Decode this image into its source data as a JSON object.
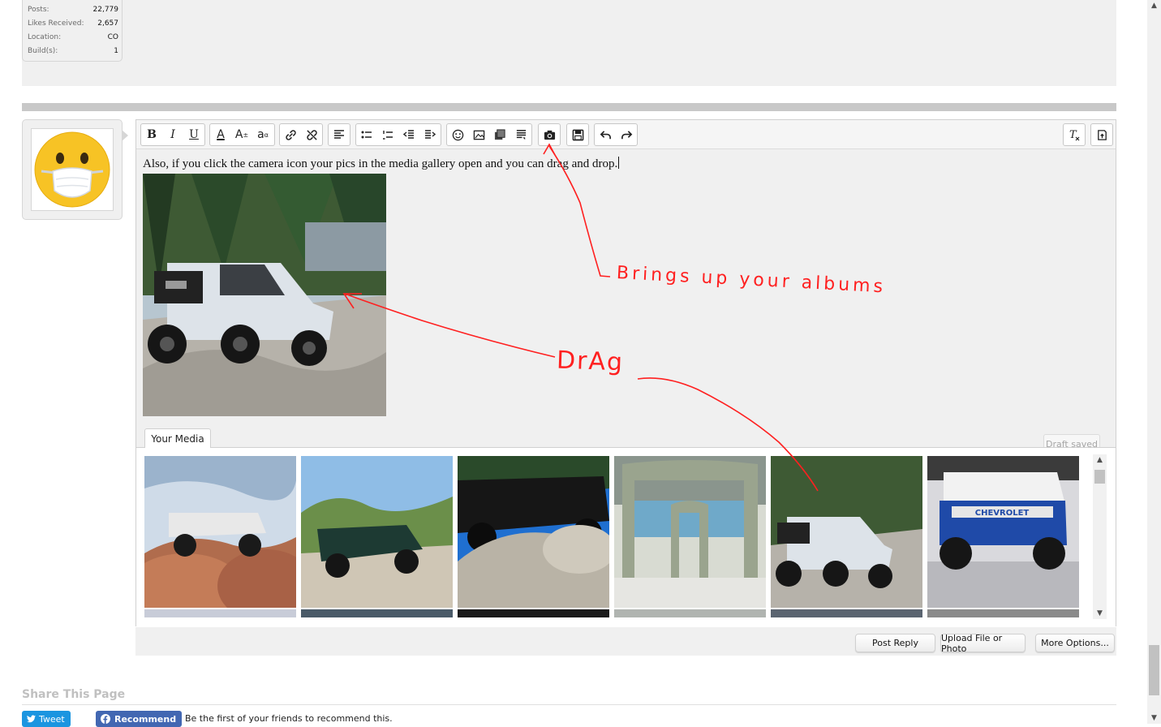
{
  "user_stats": [
    {
      "label": "Posts:",
      "value": "22,779"
    },
    {
      "label": "Likes Received:",
      "value": "2,657"
    },
    {
      "label": "Location:",
      "value": "CO"
    },
    {
      "label": "Build(s):",
      "value": "1"
    }
  ],
  "avatar": {
    "icon": "face-with-mask-emoji-icon",
    "color": "#f7c325"
  },
  "editor": {
    "toolbar": {
      "group1": [
        "B",
        "I",
        "U"
      ],
      "font_color_glyph": "A",
      "font_size_glyph": "A",
      "font_family_glyph": "a",
      "icons": [
        "bold-icon",
        "italic-icon",
        "underline-icon",
        "font-color-icon",
        "font-size-icon",
        "font-family-icon",
        "link-icon",
        "unlink-icon",
        "align-left-icon",
        "bulleted-list-icon",
        "numbered-list-icon",
        "outdent-icon",
        "indent-icon",
        "smilie-icon",
        "image-icon",
        "media-icon",
        "quote-icon",
        "camera-icon",
        "save-draft-icon",
        "undo-icon",
        "redo-icon",
        "remove-format-icon",
        "toggle-bbcode-icon"
      ]
    },
    "content_text": "Also, if you click the camera icon your pics in the media gallery open and you can drag and drop.",
    "draft_status": "Draft saved",
    "media_tab_label": "Your Media"
  },
  "buttons": {
    "post_reply": "Post Reply",
    "upload": "Upload File or Photo",
    "more_options": "More Options..."
  },
  "share": {
    "title": "Share This Page",
    "tweet_label": "Tweet",
    "fb_label": "Recommend",
    "fb_text": "Be the first of your friends to recommend this."
  },
  "annotations": {
    "albums": "Brings up your albums",
    "drag": "DrAg",
    "color": "#ff2020"
  }
}
